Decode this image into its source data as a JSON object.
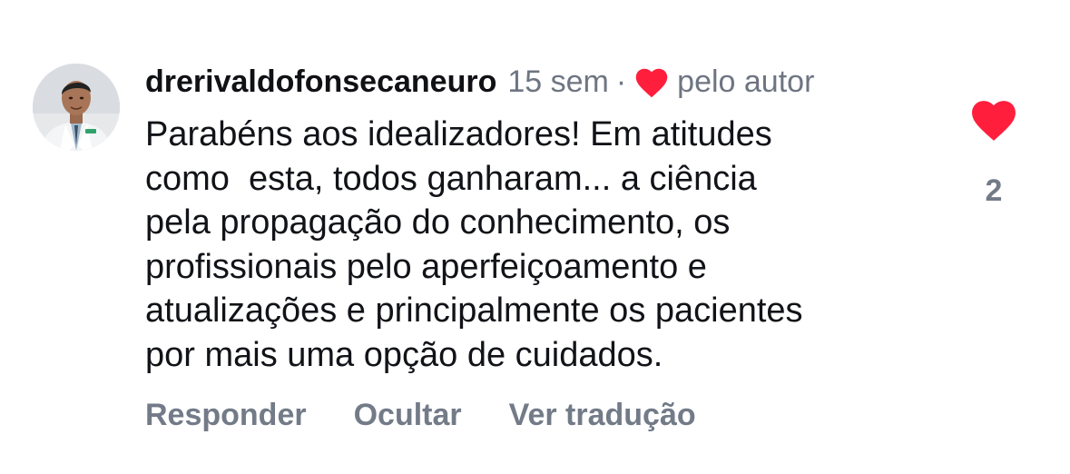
{
  "comment": {
    "username": "drerivaldofonsecaneuro",
    "time": "15 sem",
    "separator": "·",
    "liked_by_author_label": "pelo autor",
    "text": "Parabéns aos idealizadores! Em atitudes\ncomo  esta, todos ganharam... a ciência\npela propagação do conhecimento, os\nprofissionais pelo aperfeiçoamento e\natualizações e principalmente os pacientes\npor mais uma opção de cuidados.",
    "like_count": "2"
  },
  "actions": {
    "reply": "Responder",
    "hide": "Ocultar",
    "translate": "Ver tradução"
  },
  "icons": {
    "author_like": "heart-icon",
    "like": "heart-icon"
  },
  "colors": {
    "heart": "#ff1f3d",
    "muted_text": "#737b88",
    "primary_text": "#111318"
  }
}
